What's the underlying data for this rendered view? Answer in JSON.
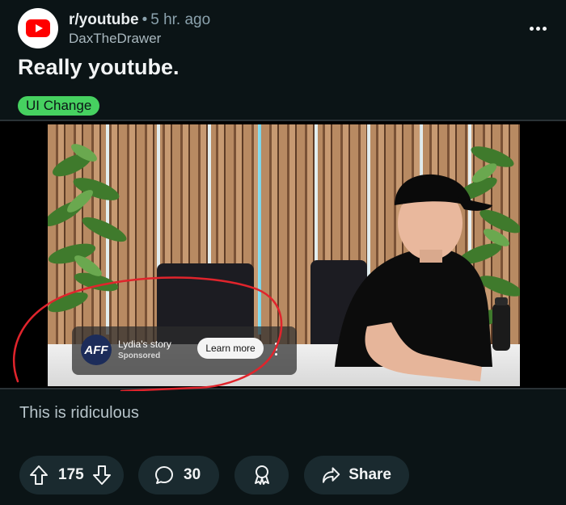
{
  "post": {
    "subreddit": "r/youtube",
    "separator": "•",
    "age": "5 hr. ago",
    "author": "DaxTheDrawer",
    "title": "Really youtube.",
    "flair": "UI Change",
    "body": "This is ridiculous"
  },
  "ad_overlay": {
    "logo_text": "AFF",
    "title": "Lydia's story",
    "subtitle": "Sponsored",
    "cta": "Learn more"
  },
  "actions": {
    "votes": "175",
    "comments": "30",
    "share": "Share"
  },
  "colors": {
    "background": "#0b1416",
    "pill": "#1a2a2f",
    "flair": "#46d160",
    "annotation": "#e0242c",
    "youtube_red": "#ff0000"
  },
  "icons": [
    "youtube-logo-icon",
    "more-icon",
    "upvote-icon",
    "downvote-icon",
    "comment-icon",
    "award-icon",
    "share-icon"
  ]
}
